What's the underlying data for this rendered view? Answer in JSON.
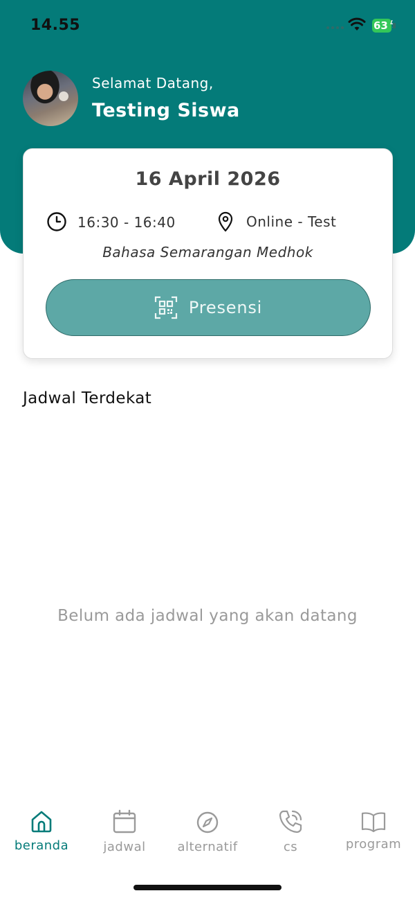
{
  "status_bar": {
    "time": "14.55",
    "battery": "63"
  },
  "header": {
    "welcome": "Selamat Datang,",
    "user_name": "Testing Siswa",
    "background_color": "#047b79"
  },
  "card": {
    "date": "16 April 2026",
    "time_range": "16:30 - 16:40",
    "location": "Online - Test",
    "subject": "Bahasa Semarangan Medhok",
    "button_label": "Presensi",
    "button_color": "#5da8a6"
  },
  "section": {
    "title": "Jadwal Terdekat",
    "empty_message": "Belum ada jadwal yang akan datang"
  },
  "nav": {
    "active_color": "#047b79",
    "items": [
      {
        "label": "beranda",
        "icon": "home-icon",
        "active": true
      },
      {
        "label": "jadwal",
        "icon": "calendar-icon",
        "active": false
      },
      {
        "label": "alternatif",
        "icon": "compass-icon",
        "active": false
      },
      {
        "label": "cs",
        "icon": "phone-icon",
        "active": false
      },
      {
        "label": "program",
        "icon": "book-icon",
        "active": false
      }
    ]
  }
}
